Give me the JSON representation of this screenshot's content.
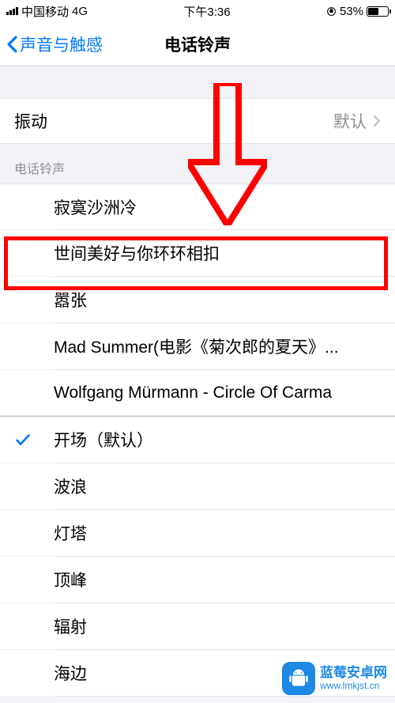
{
  "status_bar": {
    "carrier": "中国移动",
    "network": "4G",
    "time": "下午3:36",
    "battery_percent": "53%",
    "battery_fill_width": "53%"
  },
  "nav": {
    "back_label": "声音与触感",
    "title": "电话铃声"
  },
  "vibration": {
    "label": "振动",
    "value": "默认"
  },
  "section_header": "电话铃声",
  "custom_ringtones": [
    "寂寞沙洲冷",
    "世间美好与你环环相扣",
    "嚣张",
    "Mad Summer(电影《菊次郎的夏天》...",
    "Wolfgang Mürmann - Circle Of Carma"
  ],
  "builtin_ringtones": [
    {
      "label": "开场（默认）",
      "selected": true
    },
    {
      "label": "波浪",
      "selected": false
    },
    {
      "label": "灯塔",
      "selected": false
    },
    {
      "label": "顶峰",
      "selected": false
    },
    {
      "label": "辐射",
      "selected": false
    },
    {
      "label": "海边",
      "selected": false
    }
  ],
  "annotation": {
    "highlight_index": 1
  },
  "watermark": {
    "title": "蓝莓安卓网",
    "url": "www.lmkjst.cn"
  }
}
